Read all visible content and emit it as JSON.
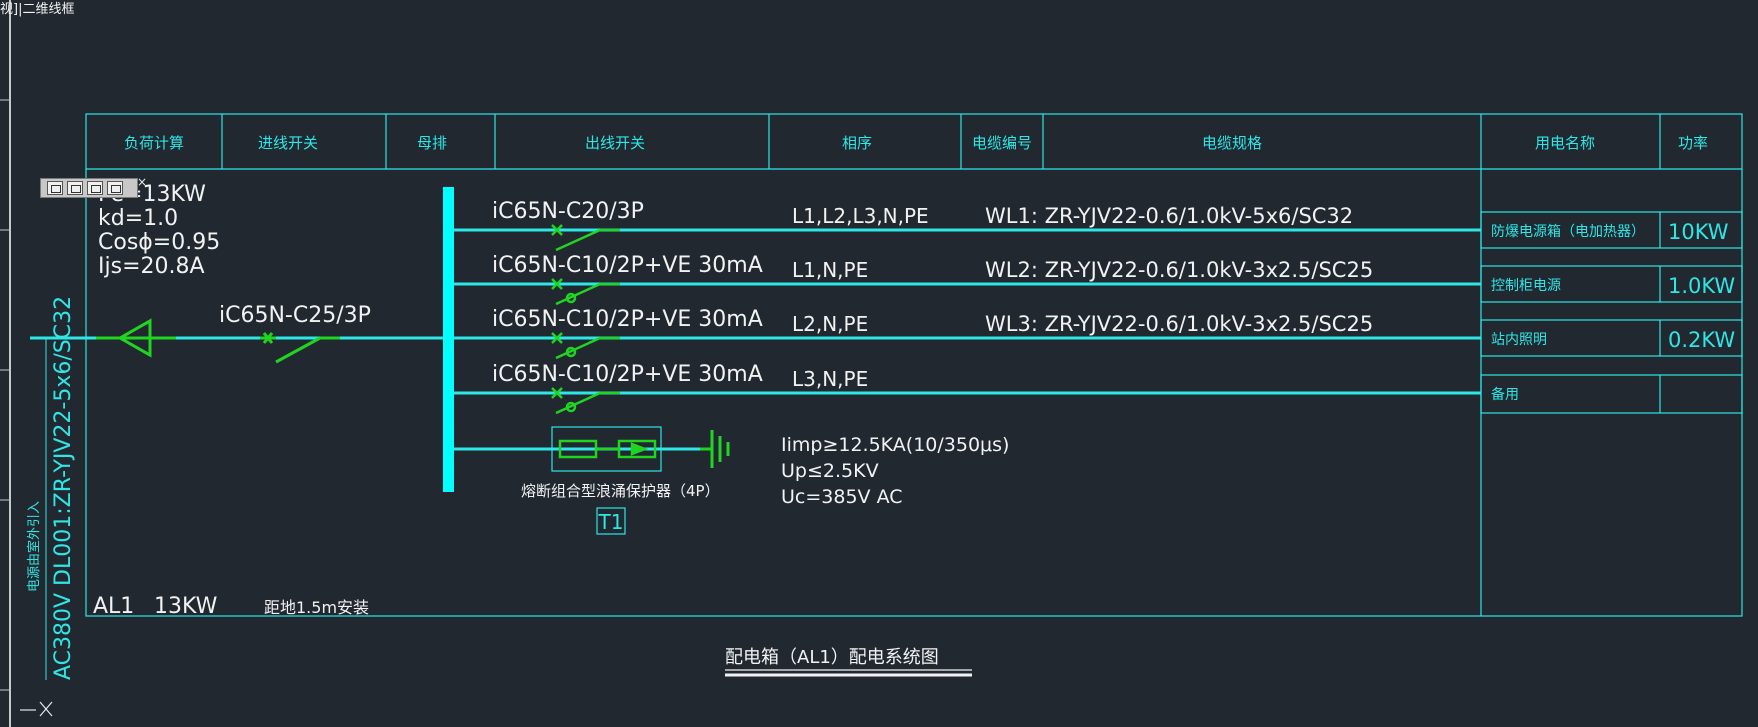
{
  "window": {
    "title_fragment": "视]|二维线框"
  },
  "colors": {
    "background": "#212830",
    "cyan": "#2ee6e6",
    "green": "#21d421",
    "white": "#f2f2f2"
  },
  "headers": [
    "负荷计算",
    "进线开关",
    "母排",
    "出线开关",
    "相序",
    "电缆编号",
    "电缆规格",
    "用电名称",
    "功率"
  ],
  "load_calc": {
    "pe": "Pe=13KW",
    "kd": "kd=1.0",
    "cos": "Cosϕ=0.95",
    "ijs": "Ijs=20.8A"
  },
  "incoming": {
    "breaker": "iC65N-C25/3P",
    "vertical_cable": "AC380V DL001:ZR-YJV22-5x6/SC32",
    "vertical_note": "电源由室外引入"
  },
  "circuits": [
    {
      "breaker": "iC65N-C20/3P",
      "phase": "L1,L2,L3,N,PE",
      "cable": "WL1: ZR-YJV22-0.6/1.0kV-5x6/SC32",
      "name": "防爆电源箱（电加热器）",
      "power": "10KW"
    },
    {
      "breaker": "iC65N-C10/2P+VE 30mA",
      "phase": "L1,N,PE",
      "cable": "WL2: ZR-YJV22-0.6/1.0kV-3x2.5/SC25",
      "name": "控制柜电源",
      "power": "1.0KW"
    },
    {
      "breaker": "iC65N-C10/2P+VE 30mA",
      "phase": "L2,N,PE",
      "cable": "WL3: ZR-YJV22-0.6/1.0kV-3x2.5/SC25",
      "name": "站内照明",
      "power": "0.2KW"
    },
    {
      "breaker": "iC65N-C10/2P+VE 30mA",
      "phase": "L3,N,PE",
      "cable": "",
      "name": "备用",
      "power": ""
    }
  ],
  "spd": {
    "label": "熔断组合型浪涌保护器（4P）",
    "tag": "T1",
    "imp": "Iimp≥12.5KA(10/350μs)",
    "up": "Up≤2.5KV",
    "uc": "Uc=385V AC"
  },
  "footer": {
    "box": "AL1",
    "power": "13KW",
    "mount": "距地1.5m安装"
  },
  "title": "配电箱（AL1）配电系统图"
}
